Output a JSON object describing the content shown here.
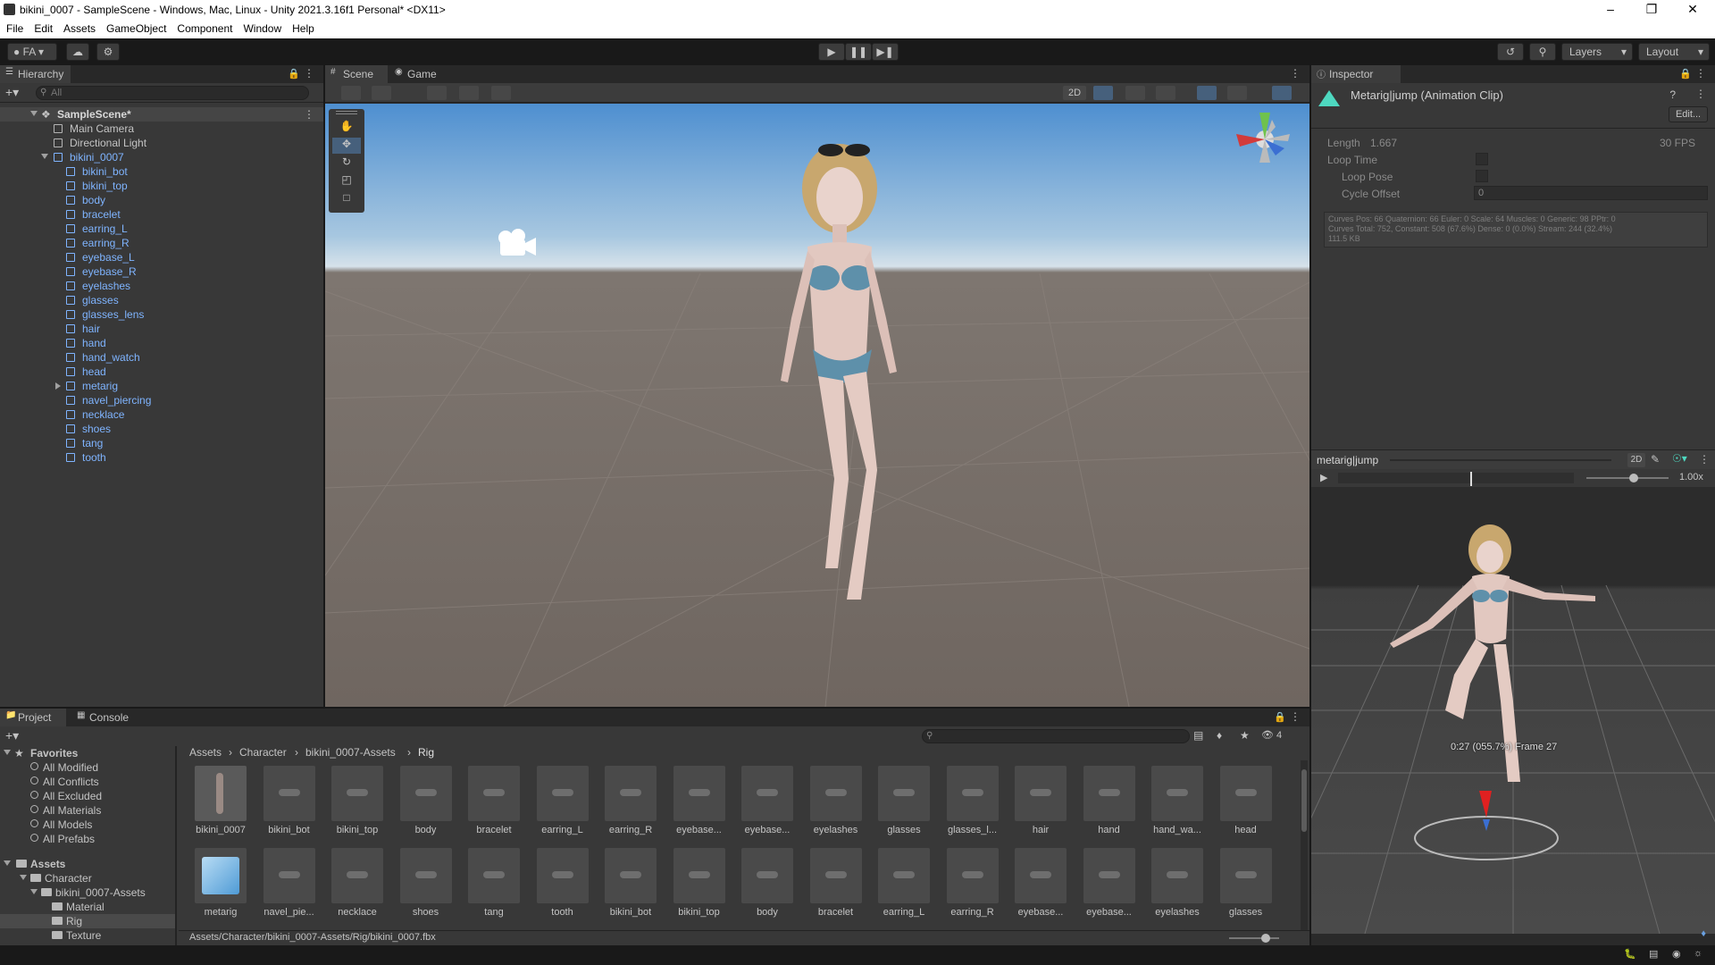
{
  "window": {
    "title": "bikini_0007 - SampleScene - Windows, Mac, Linux - Unity 2021.3.16f1 Personal* <DX11>"
  },
  "menu": [
    "File",
    "Edit",
    "Assets",
    "GameObject",
    "Component",
    "Window",
    "Help"
  ],
  "toolbar": {
    "account": "FA",
    "layers": "Layers",
    "layout": "Layout"
  },
  "hierarchy": {
    "tab": "Hierarchy",
    "search_placeholder": "All",
    "scene": "SampleScene*",
    "items": [
      {
        "label": "Main Camera",
        "depth": 1,
        "blue": false
      },
      {
        "label": "Directional Light",
        "depth": 1,
        "blue": false
      },
      {
        "label": "bikini_0007",
        "depth": 1,
        "blue": true,
        "expanded": true
      },
      {
        "label": "bikini_bot",
        "depth": 2,
        "blue": true
      },
      {
        "label": "bikini_top",
        "depth": 2,
        "blue": true
      },
      {
        "label": "body",
        "depth": 2,
        "blue": true
      },
      {
        "label": "bracelet",
        "depth": 2,
        "blue": true
      },
      {
        "label": "earring_L",
        "depth": 2,
        "blue": true
      },
      {
        "label": "earring_R",
        "depth": 2,
        "blue": true
      },
      {
        "label": "eyebase_L",
        "depth": 2,
        "blue": true
      },
      {
        "label": "eyebase_R",
        "depth": 2,
        "blue": true
      },
      {
        "label": "eyelashes",
        "depth": 2,
        "blue": true
      },
      {
        "label": "glasses",
        "depth": 2,
        "blue": true
      },
      {
        "label": "glasses_lens",
        "depth": 2,
        "blue": true
      },
      {
        "label": "hair",
        "depth": 2,
        "blue": true
      },
      {
        "label": "hand",
        "depth": 2,
        "blue": true
      },
      {
        "label": "hand_watch",
        "depth": 2,
        "blue": true
      },
      {
        "label": "head",
        "depth": 2,
        "blue": true
      },
      {
        "label": "metarig",
        "depth": 2,
        "blue": true,
        "collapsed": true
      },
      {
        "label": "navel_piercing",
        "depth": 2,
        "blue": true
      },
      {
        "label": "necklace",
        "depth": 2,
        "blue": true
      },
      {
        "label": "shoes",
        "depth": 2,
        "blue": true
      },
      {
        "label": "tang",
        "depth": 2,
        "blue": true
      },
      {
        "label": "tooth",
        "depth": 2,
        "blue": true
      }
    ]
  },
  "scene": {
    "tabs": [
      "Scene",
      "Game"
    ],
    "mode_2d": "2D"
  },
  "inspector": {
    "tab": "Inspector",
    "clip_title": "Metarig|jump (Animation Clip)",
    "edit_button": "Edit...",
    "length_label": "Length",
    "length_value": "1.667",
    "fps": "30 FPS",
    "loop_time": "Loop Time",
    "loop_pose": "Loop Pose",
    "cycle_offset": "Cycle Offset",
    "cycle_offset_value": "0",
    "curves_info_1": "Curves Pos: 66 Quaternion: 66 Euler: 0 Scale: 64 Muscles: 0 Generic: 98 PPtr: 0",
    "curves_info_2": "Curves Total: 752, Constant: 508 (67.6%) Dense: 0 (0.0%) Stream: 244 (32.4%)",
    "curves_info_3": "111.5 KB",
    "preview_title": "metarig|jump",
    "preview_2d": "2D",
    "speed": "1.00x",
    "time_readout": "0:27 (055.7%) Frame 27"
  },
  "project": {
    "tabs": [
      "Project",
      "Console"
    ],
    "favorites_label": "Favorites",
    "favorites": [
      "All Modified",
      "All Conflicts",
      "All Excluded",
      "All Materials",
      "All Models",
      "All Prefabs"
    ],
    "assets_label": "Assets",
    "tree": [
      {
        "label": "Character",
        "depth": 1
      },
      {
        "label": "bikini_0007-Assets",
        "depth": 2
      },
      {
        "label": "Material",
        "depth": 3
      },
      {
        "label": "Rig",
        "depth": 3,
        "selected": true
      },
      {
        "label": "Texture",
        "depth": 3
      }
    ],
    "breadcrumb": [
      "Assets",
      "Character",
      "bikini_0007-Assets",
      "Rig"
    ],
    "hidden_count": "4",
    "row1": [
      "bikini_0007",
      "bikini_bot",
      "bikini_top",
      "body",
      "bracelet",
      "earring_L",
      "earring_R",
      "eyebase...",
      "eyebase...",
      "eyelashes",
      "glasses",
      "glasses_l...",
      "hair",
      "hand",
      "hand_wa...",
      "head"
    ],
    "row2": [
      "metarig",
      "navel_pie...",
      "necklace",
      "shoes",
      "tang",
      "tooth",
      "bikini_bot",
      "bikini_top",
      "body",
      "bracelet",
      "earring_L",
      "earring_R",
      "eyebase...",
      "eyebase...",
      "eyelashes",
      "glasses"
    ],
    "path": "Assets/Character/bikini_0007-Assets/Rig/bikini_0007.fbx"
  }
}
